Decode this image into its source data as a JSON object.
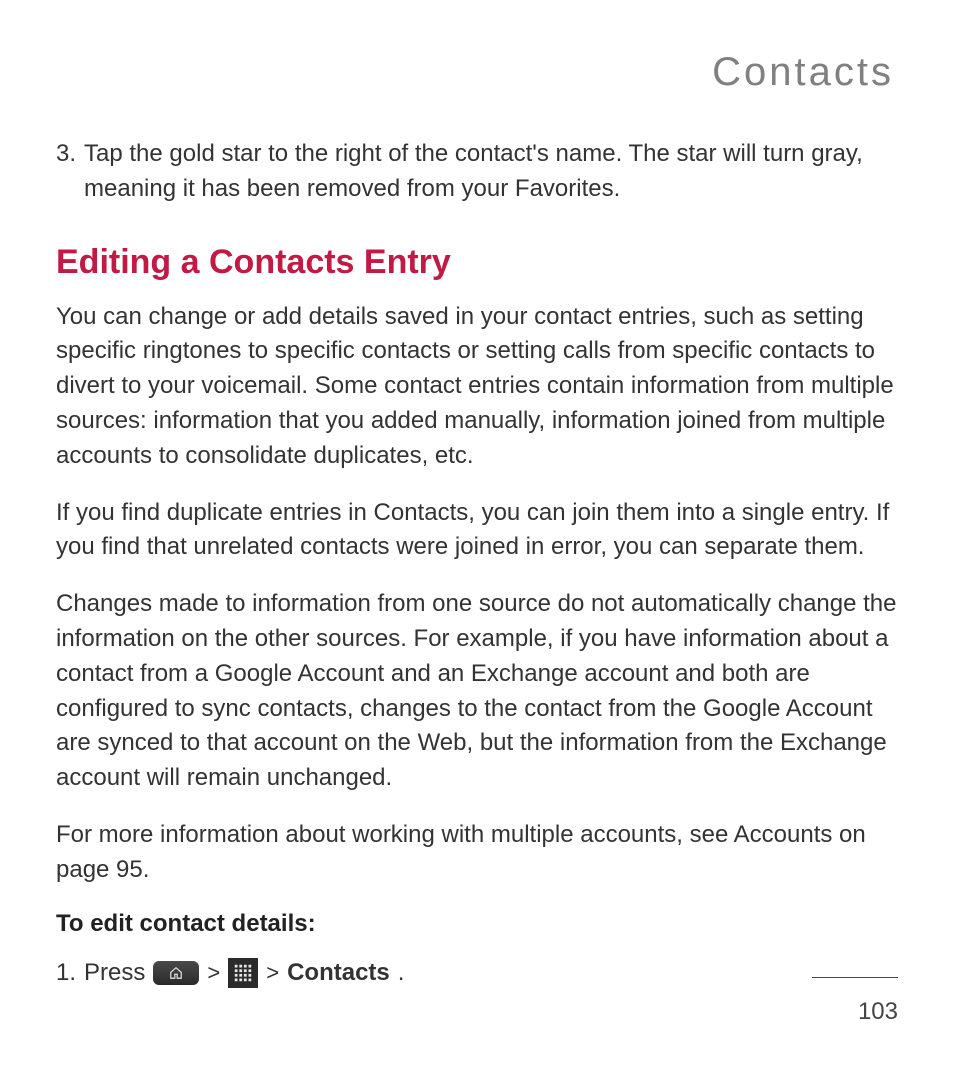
{
  "chapter": "Contacts",
  "continued_list": {
    "number": "3.",
    "text": "Tap the gold star to the right of the contact's name. The star will turn gray, meaning it has been removed from your Favorites."
  },
  "section_heading": "Editing a Contacts Entry",
  "paragraphs": {
    "p1": "You can change or add details saved in your contact entries, such as setting specific ringtones to specific contacts or setting calls from specific contacts to divert to your voicemail. Some contact entries contain information from multiple sources: information that you added manually, information joined from multiple accounts to consolidate duplicates, etc.",
    "p2": "If you find duplicate entries in Contacts, you can join them into a single entry. If you find that unrelated contacts were joined in error, you can separate them.",
    "p3": "Changes made to information from one source do not automatically change the information on the other sources. For example, if you have information about a contact from a Google Account and an Exchange account and both are configured to sync contacts, changes to the contact from the Google Account are synced to that account on the Web, but the information from the Exchange account will remain unchanged.",
    "p4": "For more information about working with multiple accounts, see Accounts on page 95."
  },
  "sub_heading": "To edit contact details:",
  "step1": {
    "number": "1.",
    "press_label": "Press",
    "caret": ">",
    "contacts_label": "Contacts",
    "period": "."
  },
  "page_number": "103"
}
